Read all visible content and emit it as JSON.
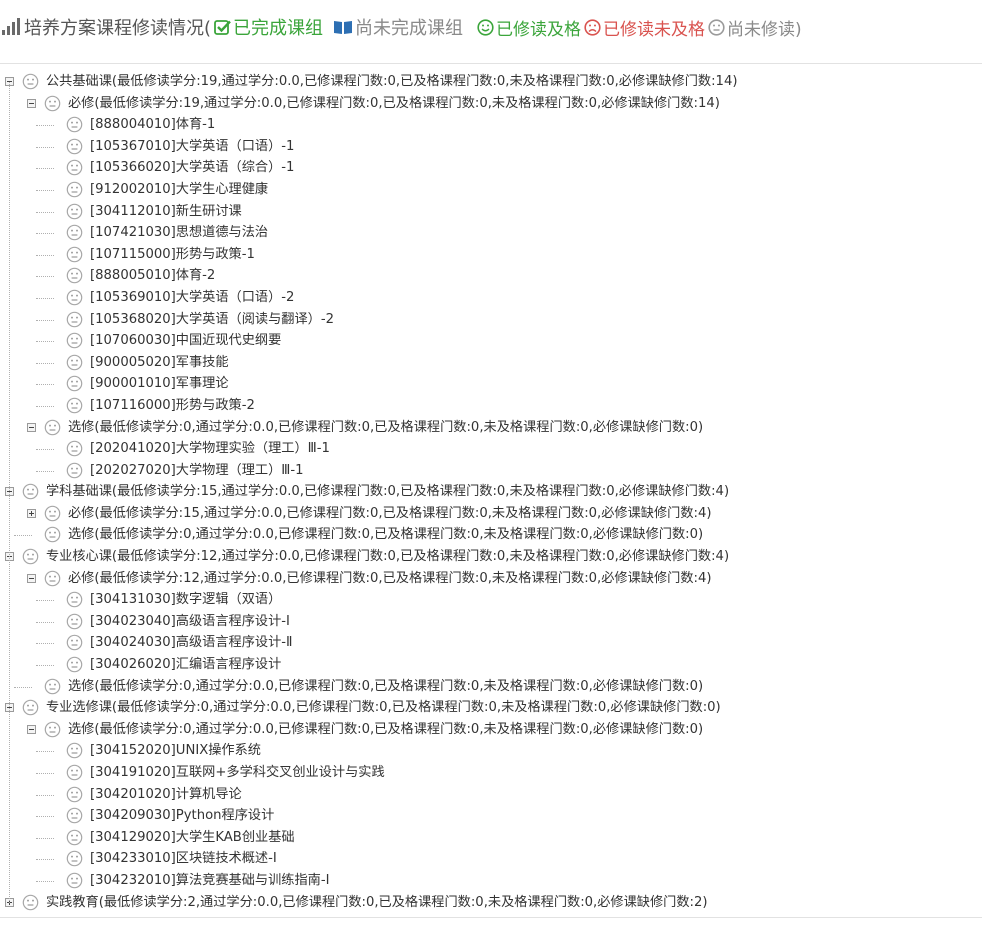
{
  "header": {
    "title": "培养方案课程修读情况(",
    "completed_group": "已完成课组",
    "uncompleted_group": "尚未完成课组",
    "passed": "已修读及格",
    "failed": "已修读未及格",
    "not_taken": "尚未修读)",
    "colors": {
      "green": "#3ba53b",
      "red": "#d9534f",
      "blue": "#2d6fb3",
      "gray": "#8a8a8a"
    }
  },
  "tree": [
    {
      "level": 0,
      "toggle": "minus",
      "text": "公共基础课(最低修读学分:19,通过学分:0.0,已修课程门数:0,已及格课程门数:0,未及格课程门数:0,必修课缺修门数:14)"
    },
    {
      "level": 1,
      "toggle": "minus",
      "text": "必修(最低修读学分:19,通过学分:0.0,已修课程门数:0,已及格课程门数:0,未及格课程门数:0,必修课缺修门数:14)"
    },
    {
      "level": 2,
      "toggle": "",
      "text": "[888004010]体育-1"
    },
    {
      "level": 2,
      "toggle": "",
      "text": "[105367010]大学英语（口语）-1"
    },
    {
      "level": 2,
      "toggle": "",
      "text": "[105366020]大学英语（综合）-1"
    },
    {
      "level": 2,
      "toggle": "",
      "text": "[912002010]大学生心理健康"
    },
    {
      "level": 2,
      "toggle": "",
      "text": "[304112010]新生研讨课"
    },
    {
      "level": 2,
      "toggle": "",
      "text": "[107421030]思想道德与法治"
    },
    {
      "level": 2,
      "toggle": "",
      "text": "[107115000]形势与政策-1"
    },
    {
      "level": 2,
      "toggle": "",
      "text": "[888005010]体育-2"
    },
    {
      "level": 2,
      "toggle": "",
      "text": "[105369010]大学英语（口语）-2"
    },
    {
      "level": 2,
      "toggle": "",
      "text": "[105368020]大学英语（阅读与翻译）-2"
    },
    {
      "level": 2,
      "toggle": "",
      "text": "[107060030]中国近现代史纲要"
    },
    {
      "level": 2,
      "toggle": "",
      "text": "[900005020]军事技能"
    },
    {
      "level": 2,
      "toggle": "",
      "text": "[900001010]军事理论"
    },
    {
      "level": 2,
      "toggle": "",
      "text": "[107116000]形势与政策-2"
    },
    {
      "level": 1,
      "toggle": "minus",
      "text": "选修(最低修读学分:0,通过学分:0.0,已修课程门数:0,已及格课程门数:0,未及格课程门数:0,必修课缺修门数:0)"
    },
    {
      "level": 2,
      "toggle": "",
      "text": "[202041020]大学物理实验（理工）Ⅲ-1"
    },
    {
      "level": 2,
      "toggle": "",
      "text": "[202027020]大学物理（理工）Ⅲ-1"
    },
    {
      "level": 0,
      "toggle": "minus",
      "text": "学科基础课(最低修读学分:15,通过学分:0.0,已修课程门数:0,已及格课程门数:0,未及格课程门数:0,必修课缺修门数:4)"
    },
    {
      "level": 1,
      "toggle": "plus",
      "text": "必修(最低修读学分:15,通过学分:0.0,已修课程门数:0,已及格课程门数:0,未及格课程门数:0,必修课缺修门数:4)"
    },
    {
      "level": 1,
      "toggle": "",
      "text": "选修(最低修读学分:0,通过学分:0.0,已修课程门数:0,已及格课程门数:0,未及格课程门数:0,必修课缺修门数:0)"
    },
    {
      "level": 0,
      "toggle": "minus",
      "text": "专业核心课(最低修读学分:12,通过学分:0.0,已修课程门数:0,已及格课程门数:0,未及格课程门数:0,必修课缺修门数:4)"
    },
    {
      "level": 1,
      "toggle": "minus",
      "text": "必修(最低修读学分:12,通过学分:0.0,已修课程门数:0,已及格课程门数:0,未及格课程门数:0,必修课缺修门数:4)"
    },
    {
      "level": 2,
      "toggle": "",
      "text": "[304131030]数字逻辑（双语）"
    },
    {
      "level": 2,
      "toggle": "",
      "text": "[304023040]高级语言程序设计-Ⅰ"
    },
    {
      "level": 2,
      "toggle": "",
      "text": "[304024030]高级语言程序设计-Ⅱ"
    },
    {
      "level": 2,
      "toggle": "",
      "text": "[304026020]汇编语言程序设计"
    },
    {
      "level": 1,
      "toggle": "",
      "text": "选修(最低修读学分:0,通过学分:0.0,已修课程门数:0,已及格课程门数:0,未及格课程门数:0,必修课缺修门数:0)"
    },
    {
      "level": 0,
      "toggle": "minus",
      "text": "专业选修课(最低修读学分:0,通过学分:0.0,已修课程门数:0,已及格课程门数:0,未及格课程门数:0,必修课缺修门数:0)"
    },
    {
      "level": 1,
      "toggle": "minus",
      "text": "选修(最低修读学分:0,通过学分:0.0,已修课程门数:0,已及格课程门数:0,未及格课程门数:0,必修课缺修门数:0)"
    },
    {
      "level": 2,
      "toggle": "",
      "text": "[304152020]UNIX操作系统"
    },
    {
      "level": 2,
      "toggle": "",
      "text": "[304191020]互联网+多学科交叉创业设计与实践"
    },
    {
      "level": 2,
      "toggle": "",
      "text": "[304201020]计算机导论"
    },
    {
      "level": 2,
      "toggle": "",
      "text": "[304209030]Python程序设计"
    },
    {
      "level": 2,
      "toggle": "",
      "text": "[304129020]大学生KAB创业基础"
    },
    {
      "level": 2,
      "toggle": "",
      "text": "[304233010]区块链技术概述-I"
    },
    {
      "level": 2,
      "toggle": "",
      "text": "[304232010]算法竞赛基础与训练指南-I"
    },
    {
      "level": 0,
      "toggle": "plus",
      "text": "实践教育(最低修读学分:2,通过学分:0.0,已修课程门数:0,已及格课程门数:0,未及格课程门数:0,必修课缺修门数:2)"
    }
  ]
}
